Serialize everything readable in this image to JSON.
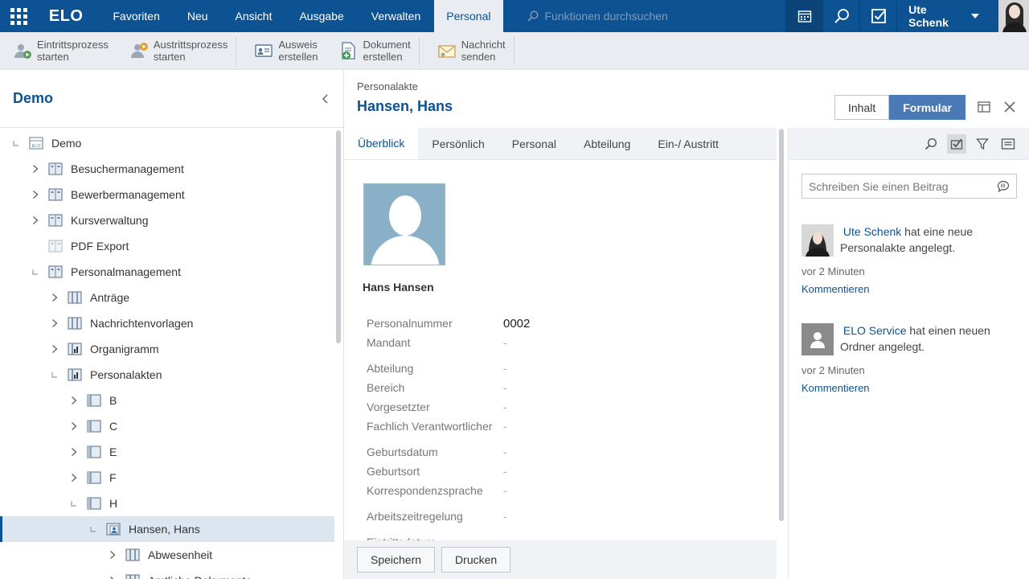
{
  "topbar": {
    "logo": "ELO",
    "menu": [
      {
        "label": "Favoriten"
      },
      {
        "label": "Neu"
      },
      {
        "label": "Ansicht"
      },
      {
        "label": "Ausgabe"
      },
      {
        "label": "Verwalten"
      },
      {
        "label": "Personal",
        "active": true
      }
    ],
    "search_placeholder": "Funktionen durchsuchen",
    "user": "Ute Schenk"
  },
  "ribbon": {
    "buttons": [
      {
        "line1": "Eintrittsprozess",
        "line2": "starten"
      },
      {
        "line1": "Austrittsprozess",
        "line2": "starten"
      },
      {
        "line1": "Ausweis",
        "line2": "erstellen"
      },
      {
        "line1": "Dokument",
        "line2": "erstellen"
      },
      {
        "line1": "Nachricht",
        "line2": "senden"
      }
    ]
  },
  "left": {
    "title": "Demo",
    "tree": [
      {
        "label": "Demo"
      },
      {
        "label": "Besuchermanagement"
      },
      {
        "label": "Bewerbermanagement"
      },
      {
        "label": "Kursverwaltung"
      },
      {
        "label": "PDF Export"
      },
      {
        "label": "Personalmanagement"
      },
      {
        "label": "Anträge"
      },
      {
        "label": "Nachrichtenvorlagen"
      },
      {
        "label": "Organigramm"
      },
      {
        "label": "Personalakten"
      },
      {
        "label": "B"
      },
      {
        "label": "C"
      },
      {
        "label": "E"
      },
      {
        "label": "F"
      },
      {
        "label": "H"
      },
      {
        "label": "Hansen, Hans"
      },
      {
        "label": "Abwesenheit"
      },
      {
        "label": "Amtliche Dokumente"
      }
    ]
  },
  "doc": {
    "breadcrumb": "Personalakte",
    "title": "Hansen, Hans",
    "view_toggle": {
      "content": "Inhalt",
      "form": "Formular"
    },
    "tabs": [
      "Überblick",
      "Persönlich",
      "Personal",
      "Abteilung",
      "Ein-/ Austritt"
    ],
    "person_name": "Hans Hansen",
    "fields": [
      {
        "label": "Personalnummer",
        "value": "0002"
      },
      {
        "label": "Mandant",
        "value": "-"
      },
      {
        "label": "Abteilung",
        "value": "-"
      },
      {
        "label": "Bereich",
        "value": "-"
      },
      {
        "label": "Vorgesetzter",
        "value": "-"
      },
      {
        "label": "Fachlich Verantwortlicher",
        "value": "-"
      },
      {
        "label": "Geburtsdatum",
        "value": "-"
      },
      {
        "label": "Geburtsort",
        "value": "-"
      },
      {
        "label": "Korrespondenzsprache",
        "value": "-"
      },
      {
        "label": "Arbeitszeitregelung",
        "value": "-"
      },
      {
        "label": "Eintrittsdatum",
        "value": ""
      }
    ],
    "buttons": {
      "save": "Speichern",
      "print": "Drucken"
    }
  },
  "feed": {
    "input_placeholder": "Schreiben Sie einen Beitrag",
    "items": [
      {
        "author": "Ute Schenk",
        "text": " hat eine neue Personalakte angelegt.",
        "time": "vor 2 Minuten",
        "comment": "Kommentieren"
      },
      {
        "author": "ELO Service",
        "text": " hat einen neuen Ordner angelegt.",
        "time": "vor 2 Minuten",
        "comment": "Kommentieren"
      }
    ]
  },
  "colors": {
    "brand": "#0d5293",
    "accent": "#4a7ab5",
    "selection": "#dbe6f1"
  }
}
